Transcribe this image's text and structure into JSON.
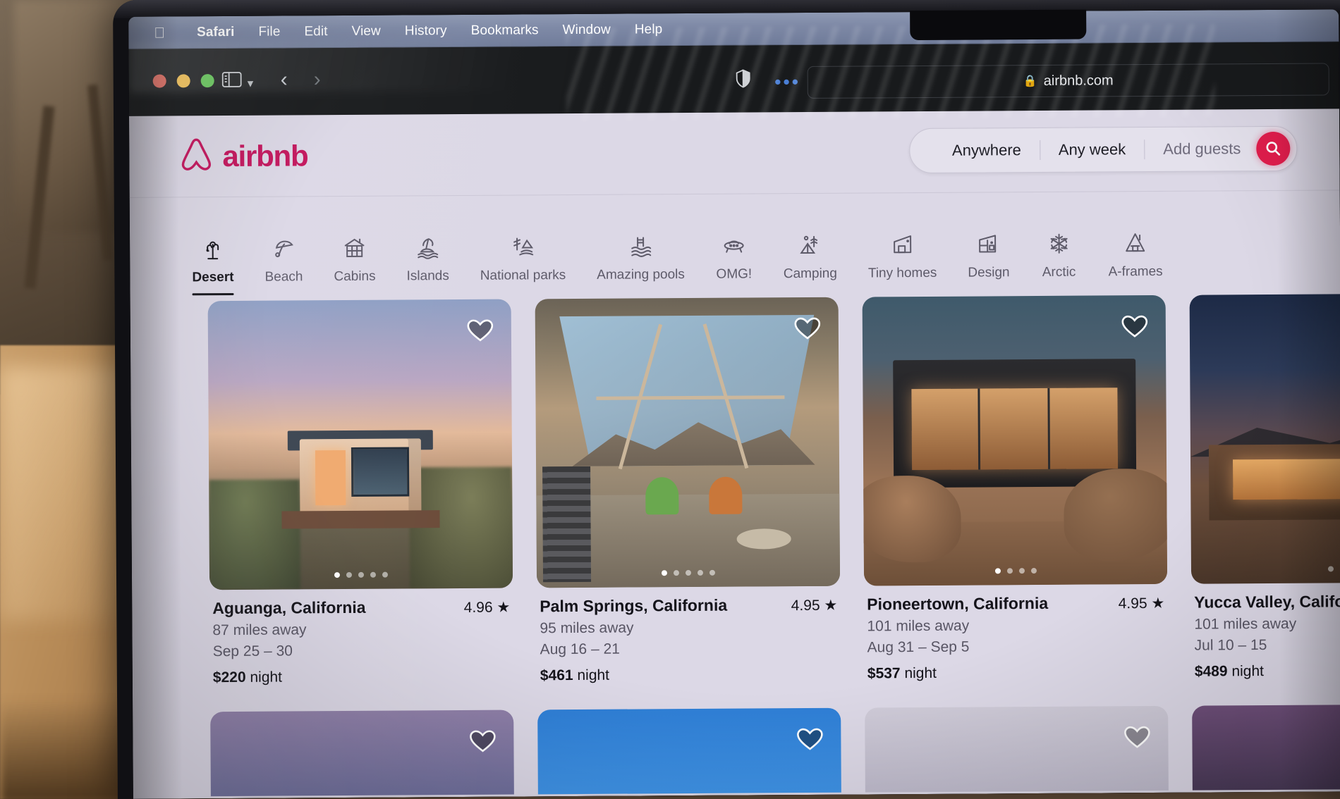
{
  "os": {
    "menubar": {
      "apple_icon": "apple-logo-icon",
      "items": [
        {
          "label": "Safari",
          "bold": true
        },
        {
          "label": "File",
          "bold": false
        },
        {
          "label": "Edit",
          "bold": false
        },
        {
          "label": "View",
          "bold": false
        },
        {
          "label": "History",
          "bold": false
        },
        {
          "label": "Bookmarks",
          "bold": false
        },
        {
          "label": "Window",
          "bold": false
        },
        {
          "label": "Help",
          "bold": false
        }
      ]
    }
  },
  "browser": {
    "name": "Safari",
    "traffic_lights": [
      "close-red",
      "minimize-yellow",
      "maximize-green"
    ],
    "sidebar_icon": "sidebar-icon",
    "tab_overview_icon": "chevron-down-icon",
    "back_icon": "chevron-left-icon",
    "forward_icon": "chevron-right-icon",
    "privacy_icon": "shield-icon",
    "more_icon": "ellipsis-icon",
    "address_bar": {
      "lock_icon": "lock-icon",
      "host": "airbnb.com"
    }
  },
  "site": {
    "brand": {
      "name": "airbnb",
      "logo_icon": "airbnb-belo-icon",
      "color": "#c3145c"
    },
    "search": {
      "where_label": "Anywhere",
      "when_label": "Any week",
      "guests_placeholder": "Add guests",
      "search_icon": "search-icon",
      "search_button_color": "#e01d4c"
    },
    "categories": [
      {
        "label": "Desert",
        "icon": "cactus-icon",
        "active": true
      },
      {
        "label": "Beach",
        "icon": "beach-umbrella-icon",
        "active": false
      },
      {
        "label": "Cabins",
        "icon": "log-cabin-icon",
        "active": false
      },
      {
        "label": "Islands",
        "icon": "palm-island-icon",
        "active": false
      },
      {
        "label": "National parks",
        "icon": "mountain-trail-icon",
        "active": false
      },
      {
        "label": "Amazing pools",
        "icon": "pool-ladder-icon",
        "active": false
      },
      {
        "label": "OMG!",
        "icon": "ufo-icon",
        "active": false
      },
      {
        "label": "Camping",
        "icon": "tent-icon",
        "active": false
      },
      {
        "label": "Tiny homes",
        "icon": "tiny-home-icon",
        "active": false
      },
      {
        "label": "Design",
        "icon": "design-house-icon",
        "active": false
      },
      {
        "label": "Arctic",
        "icon": "snowflake-icon",
        "active": false
      },
      {
        "label": "A-frames",
        "icon": "a-frame-icon",
        "active": false
      }
    ],
    "listings": [
      {
        "title": "Aguanga, California",
        "rating": "4.96",
        "distance": "87 miles away",
        "dates": "Sep 25 – 30",
        "price_amount": "$220",
        "price_unit": "night",
        "favorite_icon": "heart-icon",
        "photo_dots": 5,
        "photo_active_dot": 1
      },
      {
        "title": "Palm Springs, California",
        "rating": "4.95",
        "distance": "95 miles away",
        "dates": "Aug 16 – 21",
        "price_amount": "$461",
        "price_unit": "night",
        "favorite_icon": "heart-icon",
        "photo_dots": 5,
        "photo_active_dot": 1
      },
      {
        "title": "Pioneertown, California",
        "rating": "4.95",
        "distance": "101 miles away",
        "dates": "Aug 31 – Sep 5",
        "price_amount": "$537",
        "price_unit": "night",
        "favorite_icon": "heart-icon",
        "photo_dots": 4,
        "photo_active_dot": 1
      },
      {
        "title": "Yucca Valley, Californ",
        "rating": "",
        "distance": "101 miles away",
        "dates": "Jul 10 – 15",
        "price_amount": "$489",
        "price_unit": "night",
        "favorite_icon": "heart-icon",
        "photo_dots": 3,
        "photo_active_dot": 3
      }
    ]
  }
}
